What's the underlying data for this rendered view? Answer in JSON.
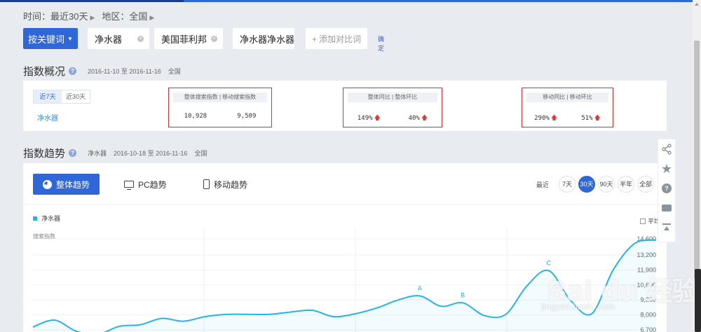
{
  "filters": {
    "time_label": "时间：最近30天",
    "region_label": "地区：全国"
  },
  "keyword_bar": {
    "mode_button": "按关键词",
    "keywords": [
      "净水器",
      "美国菲利邦",
      "净水器净水器"
    ],
    "add_compare": "+ 添加对比词",
    "confirm": "确定"
  },
  "overview": {
    "title": "指数概况",
    "date_range": "2016-11-10 至 2016-11-16",
    "region": "全国",
    "period_tabs": [
      "近7天",
      "近30天"
    ],
    "keyword": "净水器",
    "groups": [
      {
        "header": "整体搜索指数  |  移动搜索指数",
        "values": [
          "10,928",
          "9,509"
        ],
        "arrows": [
          false,
          false
        ]
      },
      {
        "header": "整体同比  |  整体环比",
        "values": [
          "149%",
          "40%"
        ],
        "arrows": [
          true,
          true
        ]
      },
      {
        "header": "移动同比  |  移动环比",
        "values": [
          "290%",
          "51%"
        ],
        "arrows": [
          true,
          true
        ]
      }
    ]
  },
  "trend": {
    "title": "指数趋势",
    "keyword": "净水器",
    "date_range": "2016-10-18 至 2016-11-16",
    "region": "全国",
    "tabs": [
      "整体趋势",
      "PC趋势",
      "移动趋势"
    ],
    "range_label": "最近",
    "range_options": [
      "7天",
      "30天",
      "90天",
      "半年",
      "全部"
    ],
    "active_range": "30天",
    "legend": "净水器",
    "average_toggle": "平均值",
    "y_axis_label": "搜索指数"
  },
  "chart_data": {
    "type": "line",
    "series": [
      {
        "name": "净水器",
        "values": [
          6950,
          7550,
          6600,
          6300,
          7000,
          7150,
          7700,
          7450,
          7850,
          8050,
          8050,
          8050,
          8250,
          8400,
          7850,
          8100,
          8600,
          9300,
          9650,
          8750,
          9050,
          7950,
          8050,
          10550,
          11850,
          9300,
          8100,
          11900,
          14200,
          14500
        ]
      }
    ],
    "y_ticks": [
      14600,
      13200,
      11900,
      10600,
      9300,
      8000,
      6700
    ],
    "ylim": [
      6700,
      14600
    ],
    "annotations": [
      {
        "label": "A",
        "index": 18
      },
      {
        "label": "B",
        "index": 20
      },
      {
        "label": "C",
        "index": 24
      }
    ],
    "ylabel": "搜索指数",
    "grid": true,
    "legend": "top-left"
  },
  "watermark": {
    "logo": "Bai du 经验",
    "url": "jingyan.baidu.com"
  },
  "colors": {
    "accent": "#2f66d8",
    "series": "#28b3e6",
    "highlight": "#e02e2e",
    "up_arrow": "#e0382e"
  },
  "side_tools": [
    "share-icon",
    "star-icon",
    "help-icon",
    "comment-icon",
    "back-to-top-icon"
  ]
}
